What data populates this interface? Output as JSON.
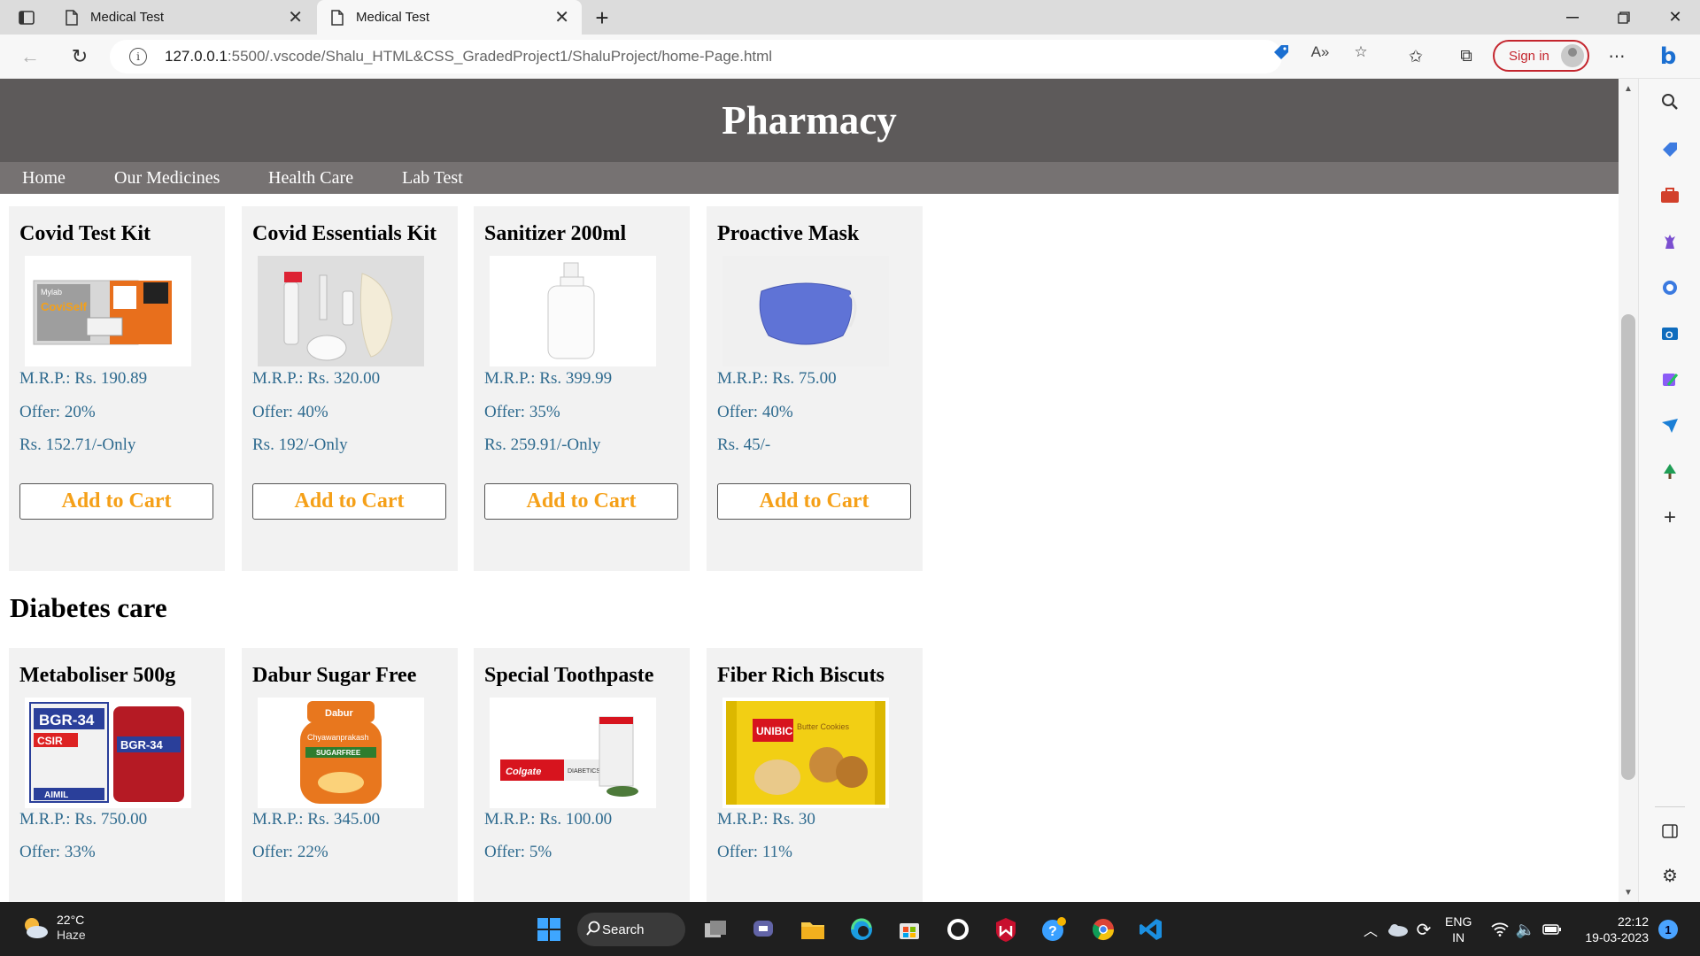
{
  "browser": {
    "tabs": [
      {
        "title": "Medical Test",
        "active": false
      },
      {
        "title": "Medical Test",
        "active": true
      }
    ],
    "new_tab_label": "+",
    "url_host": "127.0.0.1",
    "url_rest": ":5500/.vscode/Shalu_HTML&CSS_GradedProject1/ShaluProject/home-Page.html",
    "signin_label": "Sign in"
  },
  "site": {
    "title": "Pharmacy",
    "nav": [
      {
        "label": "Home"
      },
      {
        "label": "Our Medicines"
      },
      {
        "label": "Health Care"
      },
      {
        "label": "Lab Test"
      }
    ],
    "add_to_cart_label": "Add to Cart",
    "covid_products": [
      {
        "name": "Covid Test Kit",
        "mrp": "M.R.P.: Rs. 190.89",
        "offer": "Offer: 20%",
        "price": "Rs. 152.71/-Only",
        "image_icon": "covid-test-kit-image"
      },
      {
        "name": "Covid Essentials Kit",
        "mrp": "M.R.P.: Rs. 320.00",
        "offer": "Offer: 40%",
        "price": "Rs. 192/-Only",
        "image_icon": "covid-essentials-kit-image"
      },
      {
        "name": "Sanitizer 200ml",
        "mrp": "M.R.P.: Rs. 399.99",
        "offer": "Offer: 35%",
        "price": "Rs. 259.91/-Only",
        "image_icon": "sanitizer-bottle-image"
      },
      {
        "name": "Proactive Mask",
        "mrp": "M.R.P.: Rs. 75.00",
        "offer": "Offer: 40%",
        "price": "Rs. 45/-",
        "image_icon": "face-mask-image"
      }
    ],
    "diabetes_section_title": "Diabetes care",
    "diabetes_products": [
      {
        "name": "Metaboliser 500g",
        "mrp": "M.R.P.: Rs. 750.00",
        "offer": "Offer: 33%",
        "image_icon": "bgr34-product-image"
      },
      {
        "name": "Dabur Sugar Free",
        "mrp": "M.R.P.: Rs. 345.00",
        "offer": "Offer: 22%",
        "image_icon": "chyawanprakash-jar-image"
      },
      {
        "name": "Special Toothpaste",
        "mrp": "M.R.P.: Rs. 100.00",
        "offer": "Offer: 5%",
        "image_icon": "toothpaste-image"
      },
      {
        "name": "Fiber Rich Biscuts",
        "mrp": "M.R.P.: Rs. 30",
        "offer": "Offer: 11%",
        "image_icon": "biscuits-pack-image"
      }
    ],
    "image_text": {
      "covid_kit_brand": "CoviSelf",
      "covid_kit_maker": "Mylab",
      "bgr_label": "BGR-34",
      "bgr_sub": "CSIR",
      "aimil": "AIMIL",
      "dabur": "Dabur",
      "chyawan": "Chyawanprakash",
      "sugar_free": "SUGARFREE",
      "colgate": "Colgate",
      "diabetics": "DIABETICS",
      "unibic": "UNIBIC",
      "butter_cookies": "Butter Cookies"
    }
  },
  "taskbar": {
    "weather_temp": "22°C",
    "weather_condition": "Haze",
    "search_label": "Search",
    "language_top": "ENG",
    "language_bottom": "IN",
    "time": "22:12",
    "date": "19-03-2023",
    "notification_count": "1"
  },
  "colors": {
    "header_bg": "#5d5a5a",
    "nav_bg": "#767272",
    "price_text": "#2f6b8f",
    "cart_text": "#f5a018",
    "signin_accent": "#c4262e"
  }
}
